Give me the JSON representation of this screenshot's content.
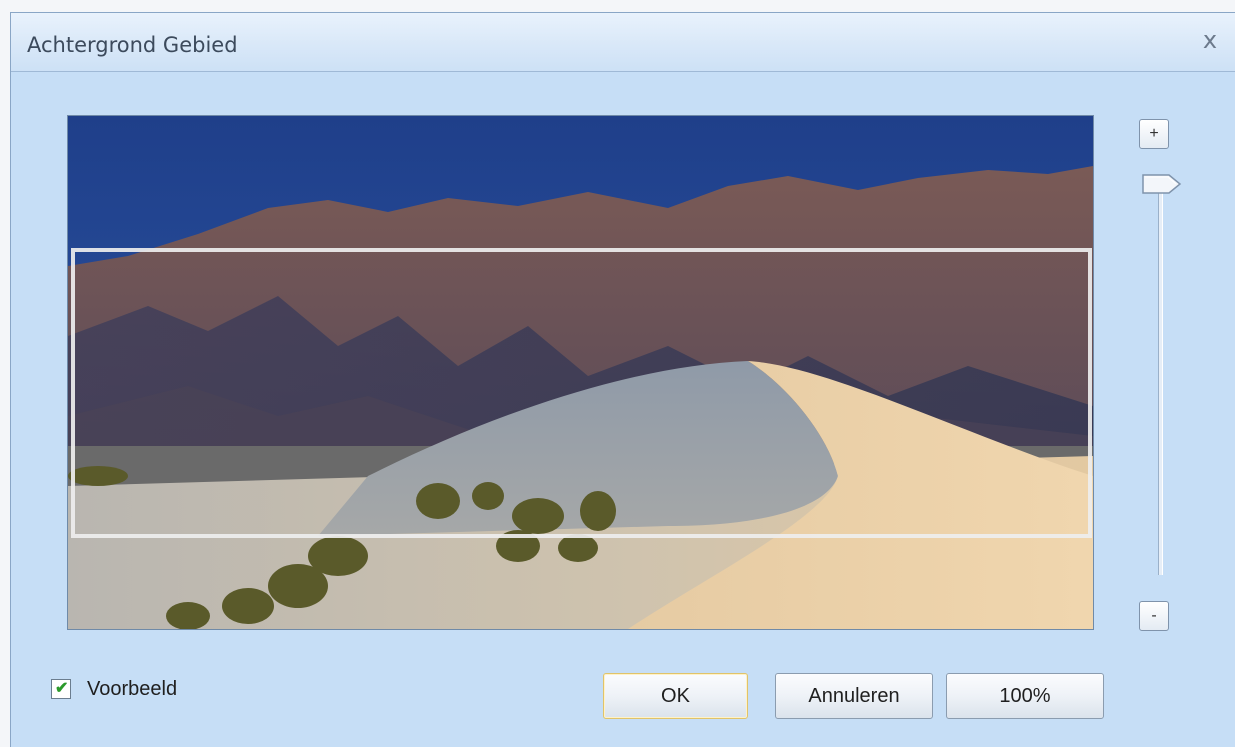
{
  "dialog": {
    "title": "Achtergrond Gebied",
    "close_glyph": "x"
  },
  "preview": {
    "image_subject": "desert sand dune in front of mountain range under blue sky",
    "crop_region": {
      "top_fraction": 0.26,
      "height_fraction": 0.56
    }
  },
  "zoom": {
    "plus_label": "+",
    "minus_label": "-",
    "level_fraction": 1.0
  },
  "preview_option": {
    "label": "Voorbeeld",
    "checked": true
  },
  "buttons": {
    "ok": "OK",
    "cancel": "Annuleren",
    "actual_size": "100%"
  },
  "colors": {
    "dialog_bg": "#c6def6",
    "check_green": "#2b9a2b",
    "ok_border": "#e0c36a"
  }
}
